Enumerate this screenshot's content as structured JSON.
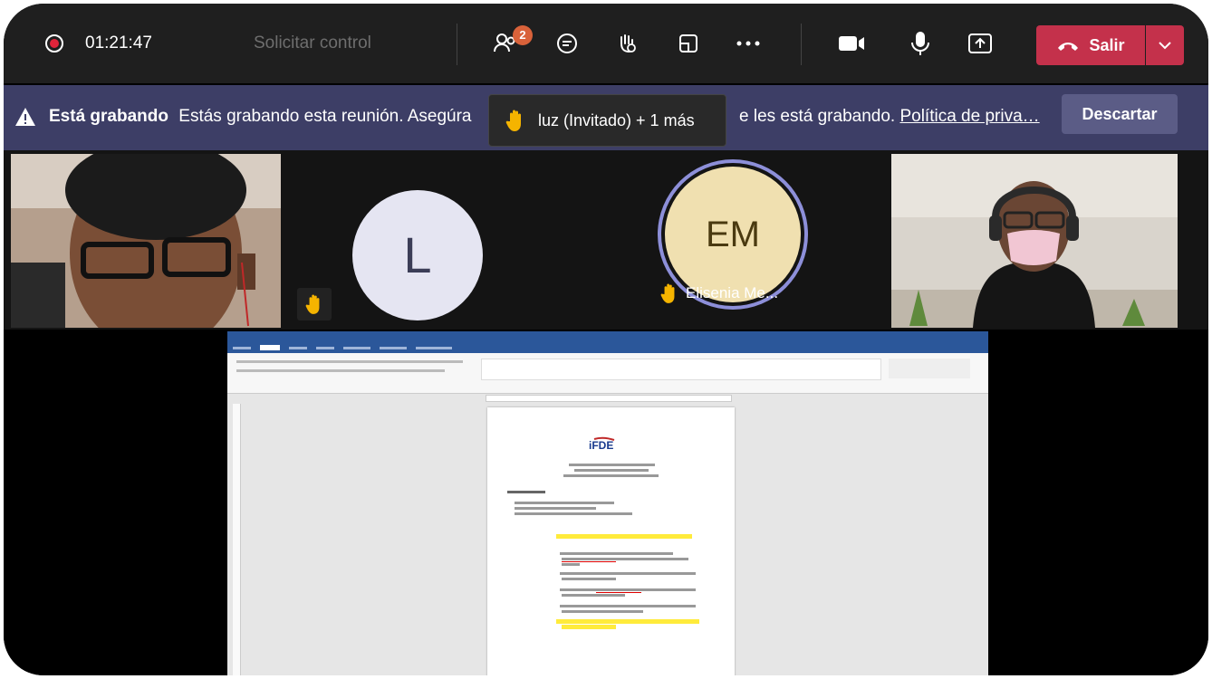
{
  "topbar": {
    "timer": "01:21:47",
    "request_control": "Solicitar control",
    "participants_badge": "2",
    "leave_label": "Salir",
    "icons": [
      "record-icon",
      "participants-icon",
      "chat-icon",
      "raise-hand-icon",
      "rooms-icon",
      "more-icon",
      "camera-icon",
      "mic-icon",
      "share-icon",
      "phone-icon",
      "chevron-down-icon"
    ]
  },
  "banner": {
    "bold": "Está grabando",
    "text_left": "Estás grabando esta reunión. Asegúra",
    "text_right": "e les está grabando.",
    "link": "Política de priva…",
    "dismiss": "Descartar"
  },
  "tooltip": {
    "text": "luz (Invitado) + 1 más"
  },
  "tiles": {
    "avatar_L": "L",
    "avatar_EM": "EM",
    "em_name": "Elisenia Me..."
  },
  "colors": {
    "accent": "#3d3e66",
    "leave": "#c4314b",
    "hand": "#f5b400",
    "word": "#2b579a"
  }
}
